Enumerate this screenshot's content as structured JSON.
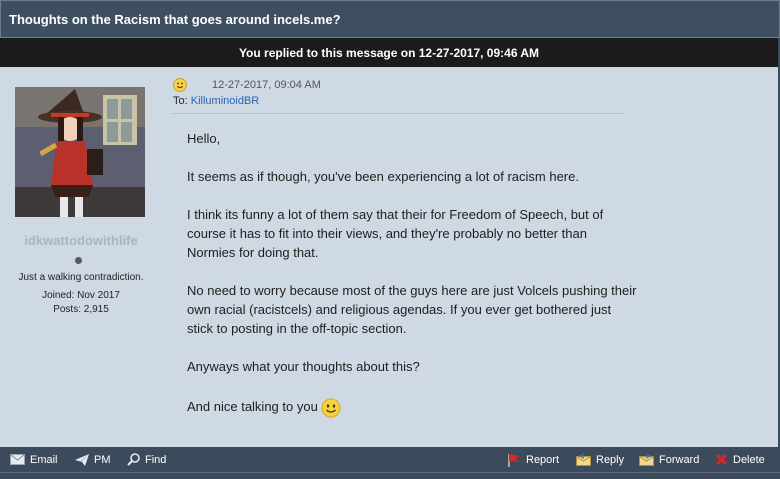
{
  "thread": {
    "title": "Thoughts on the Racism that goes around incels.me?",
    "notice": "You replied to this message on 12-27-2017, 09:46 AM"
  },
  "author": {
    "username": "idkwattodowithlife",
    "user_title": "Just a walking contradiction.",
    "joined": "Joined: Nov 2017",
    "posts": "Posts: 2,915"
  },
  "message": {
    "date": "12-27-2017, 09:04 AM",
    "to_label": "To:",
    "to_user": "KilluminoidBR",
    "paragraphs": [
      "Hello,",
      "It seems as if though, you've been experiencing a lot of racism here.",
      "I think its funny a lot of them say that their for Freedom of Speech, but of course it has to fit into their views, and they're probably no better than Normies for doing that.",
      "No need to worry because most of the guys here are just Volcels pushing their own racial (racistcels) and religious agendas. If you ever get bothered just stick to posting in the off-topic section.",
      "Anyways what your thoughts about this?",
      "And nice talking to you"
    ]
  },
  "actions": {
    "email": "Email",
    "pm": "PM",
    "find": "Find",
    "report": "Report",
    "reply": "Reply",
    "forward": "Forward",
    "delete": "Delete"
  },
  "icons": {
    "mood": "smiley-icon",
    "email": "envelope-icon",
    "pm": "paper-plane-icon",
    "find": "magnifier-icon",
    "report": "red-flag-icon",
    "reply": "reply-envelope-icon",
    "forward": "forward-envelope-icon",
    "delete": "red-x-icon"
  },
  "colors": {
    "title_bar": "#3e4f62",
    "notice_bar": "#1b1b1b",
    "post_bg": "#cfd9e3",
    "link": "#2a64b0"
  }
}
